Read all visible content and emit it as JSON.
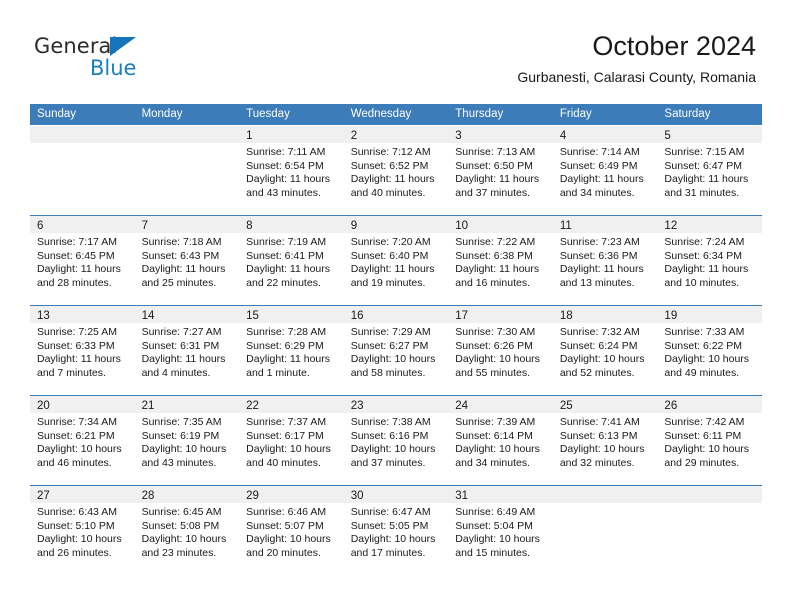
{
  "brand": {
    "name_part1": "General",
    "name_part2": "Blue",
    "logo_icon": "triangle-logo-icon"
  },
  "header": {
    "title": "October 2024",
    "subtitle": "Gurbanesti, Calarasi County, Romania"
  },
  "colors": {
    "header_blue": "#3b7cb9",
    "brand_blue": "#1a7fc1",
    "day_band_gray": "#f0f0f0"
  },
  "weekdays": [
    "Sunday",
    "Monday",
    "Tuesday",
    "Wednesday",
    "Thursday",
    "Friday",
    "Saturday"
  ],
  "weeks": [
    [
      {
        "day": "",
        "empty": true,
        "sunrise": "",
        "sunset": "",
        "daylight_line1": "",
        "daylight_line2": ""
      },
      {
        "day": "",
        "empty": true,
        "sunrise": "",
        "sunset": "",
        "daylight_line1": "",
        "daylight_line2": ""
      },
      {
        "day": "1",
        "sunrise": "Sunrise: 7:11 AM",
        "sunset": "Sunset: 6:54 PM",
        "daylight_line1": "Daylight: 11 hours",
        "daylight_line2": "and 43 minutes."
      },
      {
        "day": "2",
        "sunrise": "Sunrise: 7:12 AM",
        "sunset": "Sunset: 6:52 PM",
        "daylight_line1": "Daylight: 11 hours",
        "daylight_line2": "and 40 minutes."
      },
      {
        "day": "3",
        "sunrise": "Sunrise: 7:13 AM",
        "sunset": "Sunset: 6:50 PM",
        "daylight_line1": "Daylight: 11 hours",
        "daylight_line2": "and 37 minutes."
      },
      {
        "day": "4",
        "sunrise": "Sunrise: 7:14 AM",
        "sunset": "Sunset: 6:49 PM",
        "daylight_line1": "Daylight: 11 hours",
        "daylight_line2": "and 34 minutes."
      },
      {
        "day": "5",
        "sunrise": "Sunrise: 7:15 AM",
        "sunset": "Sunset: 6:47 PM",
        "daylight_line1": "Daylight: 11 hours",
        "daylight_line2": "and 31 minutes."
      }
    ],
    [
      {
        "day": "6",
        "sunrise": "Sunrise: 7:17 AM",
        "sunset": "Sunset: 6:45 PM",
        "daylight_line1": "Daylight: 11 hours",
        "daylight_line2": "and 28 minutes."
      },
      {
        "day": "7",
        "sunrise": "Sunrise: 7:18 AM",
        "sunset": "Sunset: 6:43 PM",
        "daylight_line1": "Daylight: 11 hours",
        "daylight_line2": "and 25 minutes."
      },
      {
        "day": "8",
        "sunrise": "Sunrise: 7:19 AM",
        "sunset": "Sunset: 6:41 PM",
        "daylight_line1": "Daylight: 11 hours",
        "daylight_line2": "and 22 minutes."
      },
      {
        "day": "9",
        "sunrise": "Sunrise: 7:20 AM",
        "sunset": "Sunset: 6:40 PM",
        "daylight_line1": "Daylight: 11 hours",
        "daylight_line2": "and 19 minutes."
      },
      {
        "day": "10",
        "sunrise": "Sunrise: 7:22 AM",
        "sunset": "Sunset: 6:38 PM",
        "daylight_line1": "Daylight: 11 hours",
        "daylight_line2": "and 16 minutes."
      },
      {
        "day": "11",
        "sunrise": "Sunrise: 7:23 AM",
        "sunset": "Sunset: 6:36 PM",
        "daylight_line1": "Daylight: 11 hours",
        "daylight_line2": "and 13 minutes."
      },
      {
        "day": "12",
        "sunrise": "Sunrise: 7:24 AM",
        "sunset": "Sunset: 6:34 PM",
        "daylight_line1": "Daylight: 11 hours",
        "daylight_line2": "and 10 minutes."
      }
    ],
    [
      {
        "day": "13",
        "sunrise": "Sunrise: 7:25 AM",
        "sunset": "Sunset: 6:33 PM",
        "daylight_line1": "Daylight: 11 hours",
        "daylight_line2": "and 7 minutes."
      },
      {
        "day": "14",
        "sunrise": "Sunrise: 7:27 AM",
        "sunset": "Sunset: 6:31 PM",
        "daylight_line1": "Daylight: 11 hours",
        "daylight_line2": "and 4 minutes."
      },
      {
        "day": "15",
        "sunrise": "Sunrise: 7:28 AM",
        "sunset": "Sunset: 6:29 PM",
        "daylight_line1": "Daylight: 11 hours",
        "daylight_line2": "and 1 minute."
      },
      {
        "day": "16",
        "sunrise": "Sunrise: 7:29 AM",
        "sunset": "Sunset: 6:27 PM",
        "daylight_line1": "Daylight: 10 hours",
        "daylight_line2": "and 58 minutes."
      },
      {
        "day": "17",
        "sunrise": "Sunrise: 7:30 AM",
        "sunset": "Sunset: 6:26 PM",
        "daylight_line1": "Daylight: 10 hours",
        "daylight_line2": "and 55 minutes."
      },
      {
        "day": "18",
        "sunrise": "Sunrise: 7:32 AM",
        "sunset": "Sunset: 6:24 PM",
        "daylight_line1": "Daylight: 10 hours",
        "daylight_line2": "and 52 minutes."
      },
      {
        "day": "19",
        "sunrise": "Sunrise: 7:33 AM",
        "sunset": "Sunset: 6:22 PM",
        "daylight_line1": "Daylight: 10 hours",
        "daylight_line2": "and 49 minutes."
      }
    ],
    [
      {
        "day": "20",
        "sunrise": "Sunrise: 7:34 AM",
        "sunset": "Sunset: 6:21 PM",
        "daylight_line1": "Daylight: 10 hours",
        "daylight_line2": "and 46 minutes."
      },
      {
        "day": "21",
        "sunrise": "Sunrise: 7:35 AM",
        "sunset": "Sunset: 6:19 PM",
        "daylight_line1": "Daylight: 10 hours",
        "daylight_line2": "and 43 minutes."
      },
      {
        "day": "22",
        "sunrise": "Sunrise: 7:37 AM",
        "sunset": "Sunset: 6:17 PM",
        "daylight_line1": "Daylight: 10 hours",
        "daylight_line2": "and 40 minutes."
      },
      {
        "day": "23",
        "sunrise": "Sunrise: 7:38 AM",
        "sunset": "Sunset: 6:16 PM",
        "daylight_line1": "Daylight: 10 hours",
        "daylight_line2": "and 37 minutes."
      },
      {
        "day": "24",
        "sunrise": "Sunrise: 7:39 AM",
        "sunset": "Sunset: 6:14 PM",
        "daylight_line1": "Daylight: 10 hours",
        "daylight_line2": "and 34 minutes."
      },
      {
        "day": "25",
        "sunrise": "Sunrise: 7:41 AM",
        "sunset": "Sunset: 6:13 PM",
        "daylight_line1": "Daylight: 10 hours",
        "daylight_line2": "and 32 minutes."
      },
      {
        "day": "26",
        "sunrise": "Sunrise: 7:42 AM",
        "sunset": "Sunset: 6:11 PM",
        "daylight_line1": "Daylight: 10 hours",
        "daylight_line2": "and 29 minutes."
      }
    ],
    [
      {
        "day": "27",
        "sunrise": "Sunrise: 6:43 AM",
        "sunset": "Sunset: 5:10 PM",
        "daylight_line1": "Daylight: 10 hours",
        "daylight_line2": "and 26 minutes."
      },
      {
        "day": "28",
        "sunrise": "Sunrise: 6:45 AM",
        "sunset": "Sunset: 5:08 PM",
        "daylight_line1": "Daylight: 10 hours",
        "daylight_line2": "and 23 minutes."
      },
      {
        "day": "29",
        "sunrise": "Sunrise: 6:46 AM",
        "sunset": "Sunset: 5:07 PM",
        "daylight_line1": "Daylight: 10 hours",
        "daylight_line2": "and 20 minutes."
      },
      {
        "day": "30",
        "sunrise": "Sunrise: 6:47 AM",
        "sunset": "Sunset: 5:05 PM",
        "daylight_line1": "Daylight: 10 hours",
        "daylight_line2": "and 17 minutes."
      },
      {
        "day": "31",
        "sunrise": "Sunrise: 6:49 AM",
        "sunset": "Sunset: 5:04 PM",
        "daylight_line1": "Daylight: 10 hours",
        "daylight_line2": "and 15 minutes."
      },
      {
        "day": "",
        "empty": true,
        "sunrise": "",
        "sunset": "",
        "daylight_line1": "",
        "daylight_line2": ""
      },
      {
        "day": "",
        "empty": true,
        "sunrise": "",
        "sunset": "",
        "daylight_line1": "",
        "daylight_line2": ""
      }
    ]
  ]
}
